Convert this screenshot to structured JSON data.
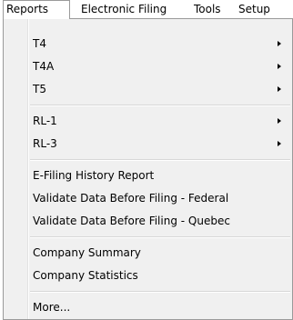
{
  "menubar": {
    "items": [
      {
        "label": "Reports"
      },
      {
        "label": "Electronic Filing"
      },
      {
        "label": "Tools"
      },
      {
        "label": "Setup"
      }
    ]
  },
  "reports_menu": {
    "items": [
      {
        "label": "T4",
        "submenu": true
      },
      {
        "label": "T4A",
        "submenu": true
      },
      {
        "label": "T5",
        "submenu": true
      },
      {
        "label": "RL-1",
        "submenu": true
      },
      {
        "label": "RL-3",
        "submenu": true
      },
      {
        "label": "E-Filing History Report",
        "submenu": false
      },
      {
        "label": "Validate Data Before Filing - Federal",
        "submenu": false
      },
      {
        "label": "Validate Data Before Filing - Quebec",
        "submenu": false
      },
      {
        "label": "Company Summary",
        "submenu": false
      },
      {
        "label": "Company Statistics",
        "submenu": false
      },
      {
        "label": "More...",
        "submenu": false
      }
    ],
    "submenu_icon": "chevron-right-icon"
  }
}
